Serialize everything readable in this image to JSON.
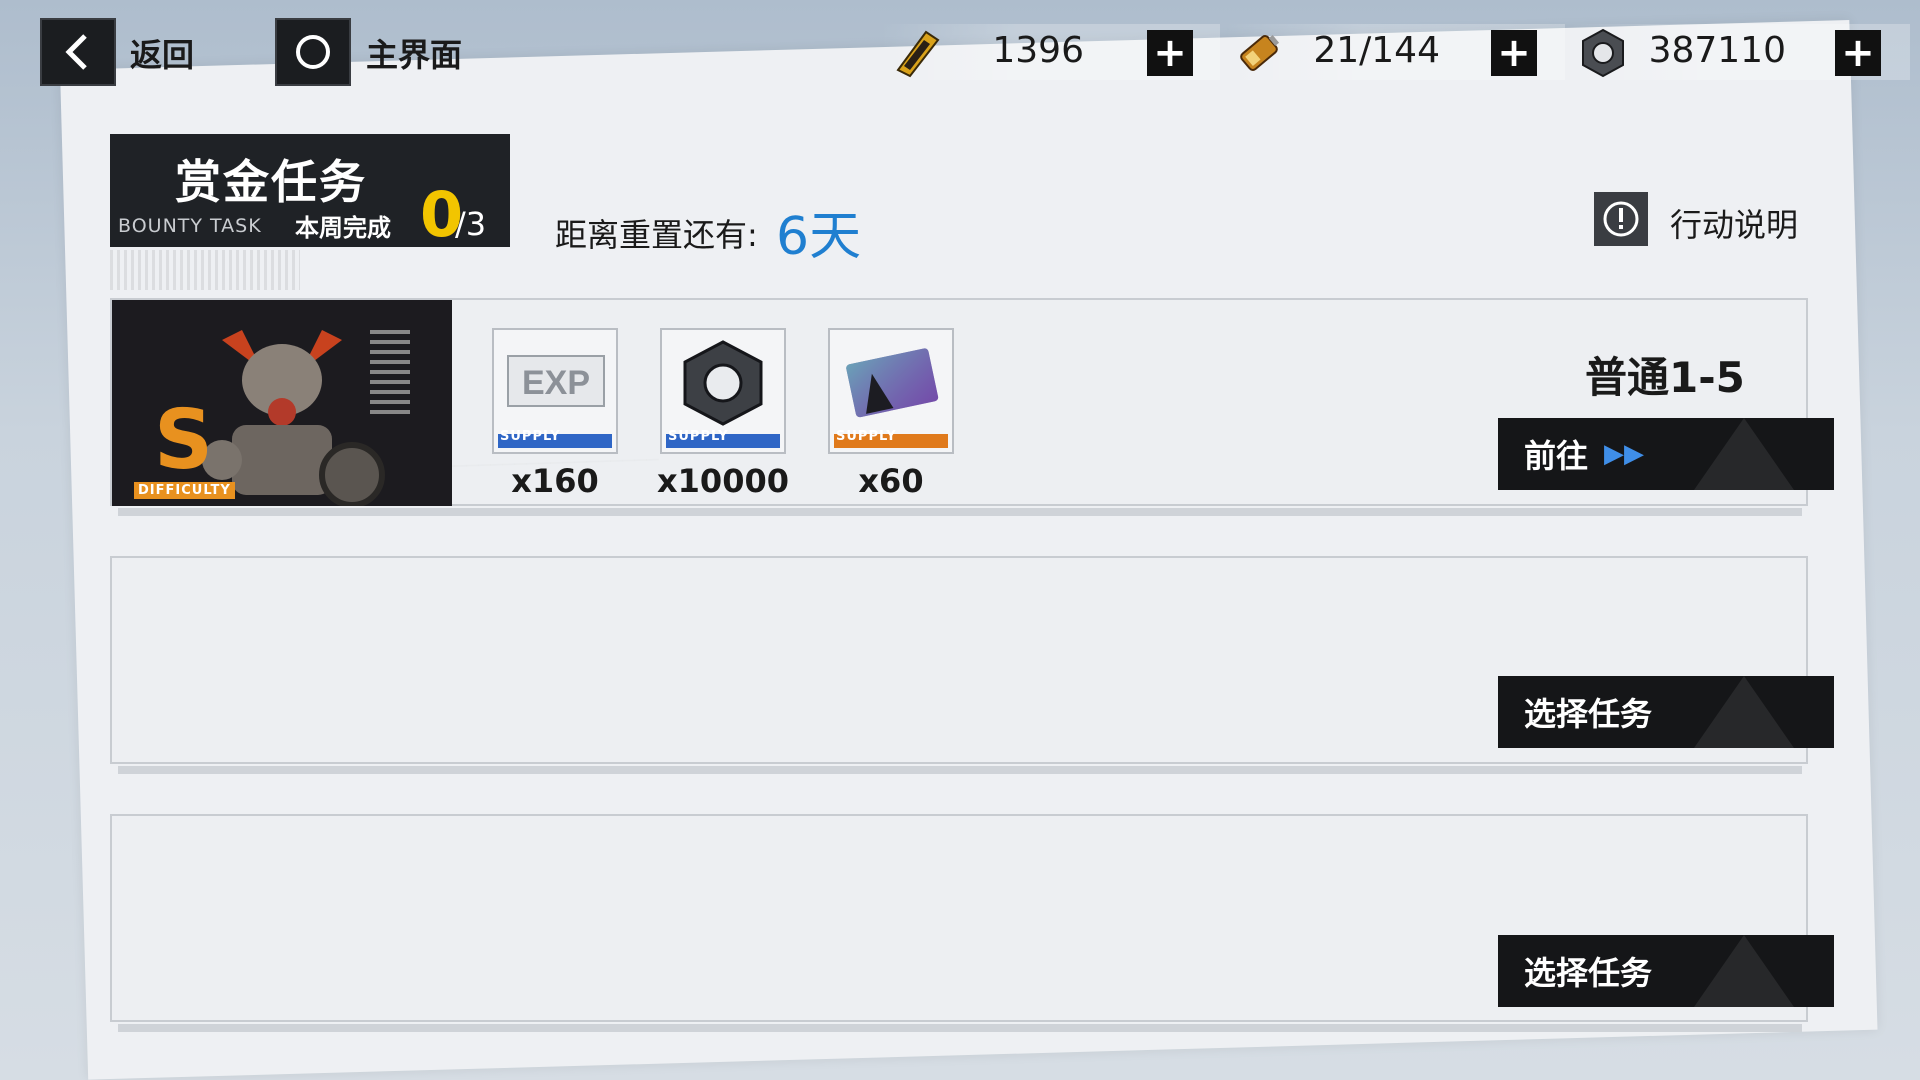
{
  "nav": {
    "back_label": "返回",
    "home_label": "主界面"
  },
  "resources": [
    {
      "icon": "ticket-icon",
      "value": "1396"
    },
    {
      "icon": "battery-icon",
      "value": "21/144"
    },
    {
      "icon": "coin-icon",
      "value": "387110"
    }
  ],
  "header": {
    "title": "赏金任务",
    "subtitle": "BOUNTY TASK",
    "weekly_label": "本周完成",
    "weekly_done": "0",
    "weekly_total": "/3",
    "reset_label": "距离重置还有:",
    "reset_value": "6天",
    "info_label": "行动说明"
  },
  "tasks": [
    {
      "difficulty": "S",
      "difficulty_label": "DIFFICULTY",
      "stage": "普通1-5",
      "action": "前往",
      "rewards": [
        {
          "icon": "exp-supply-icon",
          "tag": "SUPPLY",
          "qty": "x160"
        },
        {
          "icon": "nut-supply-icon",
          "tag": "SUPPLY",
          "qty": "x10000"
        },
        {
          "icon": "memory-card-supply-icon",
          "tag": "SUPPLY",
          "qty": "x60"
        }
      ]
    },
    {
      "action": "选择任务"
    },
    {
      "action": "选择任务"
    }
  ],
  "colors": {
    "accent_yellow": "#f2c500",
    "accent_blue": "#1f7fd0",
    "button_dark": "#151618"
  }
}
